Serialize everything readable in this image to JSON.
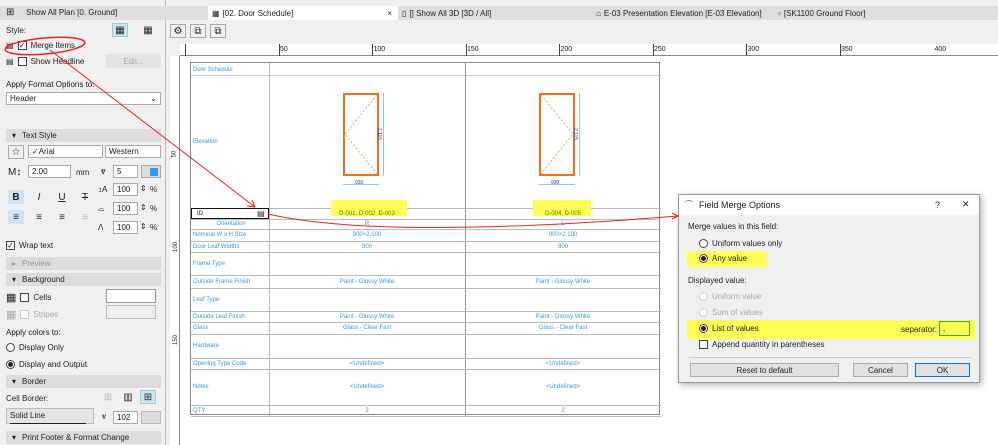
{
  "tabs": [
    {
      "label": "Show All Plan [0. Ground]"
    },
    {
      "label": "[02. Door Schedule]"
    },
    {
      "label": "[] Show All 3D [3D / All]"
    },
    {
      "label": "E-03 Presentation Elevation [E-03 Elevation]"
    },
    {
      "label": "[SK1100 Ground Floor]"
    }
  ],
  "tab_close": "×",
  "left": {
    "style_label": "Style:",
    "merge_items": "Merge Items",
    "show_headline": "Show Headline",
    "edit": "Edit...",
    "apply_format": "Apply Format Options to:",
    "apply_value": "Header",
    "text_style": "Text Style",
    "font": "✓Arial",
    "script": "Western",
    "size": "2.00",
    "size_unit": "mm",
    "pen": "5",
    "pct1": "100",
    "pct2": "100",
    "pct3": "100",
    "pct": "%",
    "wrap_text": "Wrap text",
    "preview": "Preview",
    "background": "Background",
    "cells": "Cells",
    "stripes": "Stripes",
    "apply_colors": "Apply colors to:",
    "display_only": "Display Only",
    "display_output": "Display and Output",
    "border": "Border",
    "cell_border": "Cell Border:",
    "line_type": "Solid Line",
    "border_pen": "102",
    "print_footer": "Print Footer & Format Change"
  },
  "ruler": [
    "50",
    "100",
    "150",
    "200",
    "250",
    "300",
    "350",
    "400"
  ],
  "ruler_v": [
    "50",
    "100",
    "150"
  ],
  "schedule": {
    "title": "Door Schedule",
    "rows": [
      {
        "label": "Elevation",
        "v1": "",
        "v2": ""
      },
      {
        "label": "ID",
        "v1": "D-001, D-002, D-003",
        "v2": "D-004, D-005"
      },
      {
        "label": "Orientation",
        "v1": "R",
        "v2": "L"
      },
      {
        "label": "Nominal W x H Size",
        "v1": "900×2,100",
        "v2": "900×2,100"
      },
      {
        "label": "Door Leaf Widths",
        "v1": "900",
        "v2": "900"
      },
      {
        "label": "Frame Type",
        "v1": "",
        "v2": ""
      },
      {
        "label": "Outside Frame Finish",
        "v1": "Paint - Glossy White",
        "v2": "Paint - Glossy White"
      },
      {
        "label": "Leaf Type",
        "v1": "",
        "v2": ""
      },
      {
        "label": "Outside Leaf Finish",
        "v1": "Paint - Glossy White",
        "v2": "Paint - Glossy White"
      },
      {
        "label": "Glass",
        "v1": "Glass - Clear Fast",
        "v2": "Glass - Clear Fast"
      },
      {
        "label": "Hardware",
        "v1": "",
        "v2": ""
      },
      {
        "label": "Opening Type Code",
        "v1": "<Undefined>",
        "v2": "<Undefined>"
      },
      {
        "label": "Notes",
        "v1": "<Undefined>",
        "v2": "<Undefined>"
      },
      {
        "label": "QTY",
        "v1": "3",
        "v2": "2"
      }
    ],
    "dim_h": "2,115",
    "dim_w": "930"
  },
  "dialog": {
    "title": "Field Merge Options",
    "help": "?",
    "close": "✕",
    "merge_label": "Merge values in this field:",
    "uniform_only": "Uniform values only",
    "any_value": "Any value",
    "displayed": "Displayed value:",
    "uniform_value": "Uniform value",
    "sum_values": "Sum of values",
    "list_values": "List of values",
    "separator_label": "separator:",
    "separator_value": ",",
    "append_qty": "Append quantity in parentheses",
    "reset": "Reset to default",
    "cancel": "Cancel",
    "ok": "OK"
  }
}
